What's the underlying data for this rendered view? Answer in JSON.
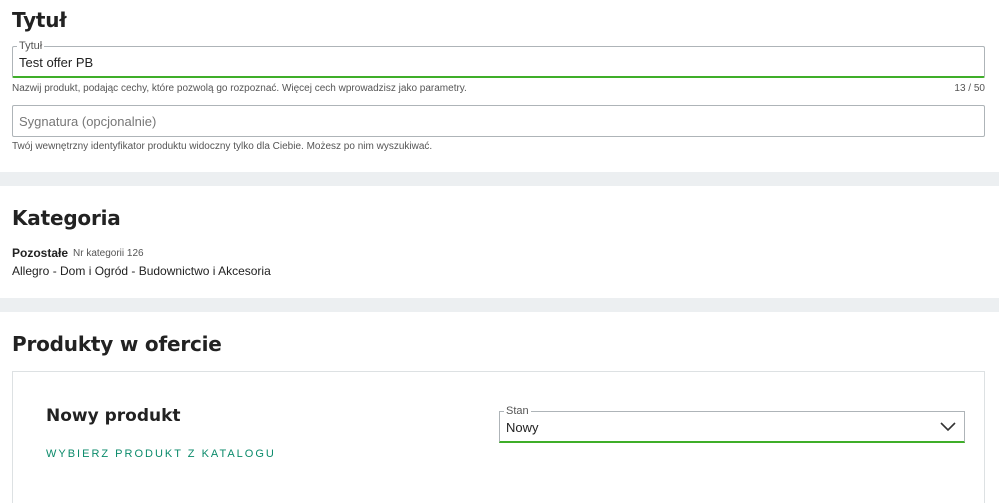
{
  "title_section": {
    "heading": "Tytuł",
    "title_field": {
      "legend": "Tytuł",
      "value": "Test offer PB",
      "helper": "Nazwij produkt, podając cechy, które pozwolą go rozpoznać. Więcej cech wprowadzisz jako parametry.",
      "counter": "13  /  50"
    },
    "signature_field": {
      "placeholder": "Sygnatura (opcjonalnie)",
      "helper": "Twój wewnętrzny identyfikator produktu widoczny tylko dla Ciebie. Możesz po nim wyszukiwać."
    }
  },
  "category_section": {
    "heading": "Kategoria",
    "name": "Pozostałe",
    "number": "Nr kategorii 126",
    "path": "Allegro - Dom i Ogród - Budownictwo i Akcesoria"
  },
  "products_section": {
    "heading": "Produkty w ofercie",
    "card": {
      "title": "Nowy produkt",
      "catalog_link": "WYBIERZ PRODUKT Z KATALOGU",
      "condition_select": {
        "legend": "Stan",
        "value": "Nowy",
        "icon": "chevron-down-icon"
      }
    }
  },
  "colors": {
    "accent_green": "#3fae29",
    "link_teal": "#0a8a6a",
    "separator": "#eceff1"
  }
}
